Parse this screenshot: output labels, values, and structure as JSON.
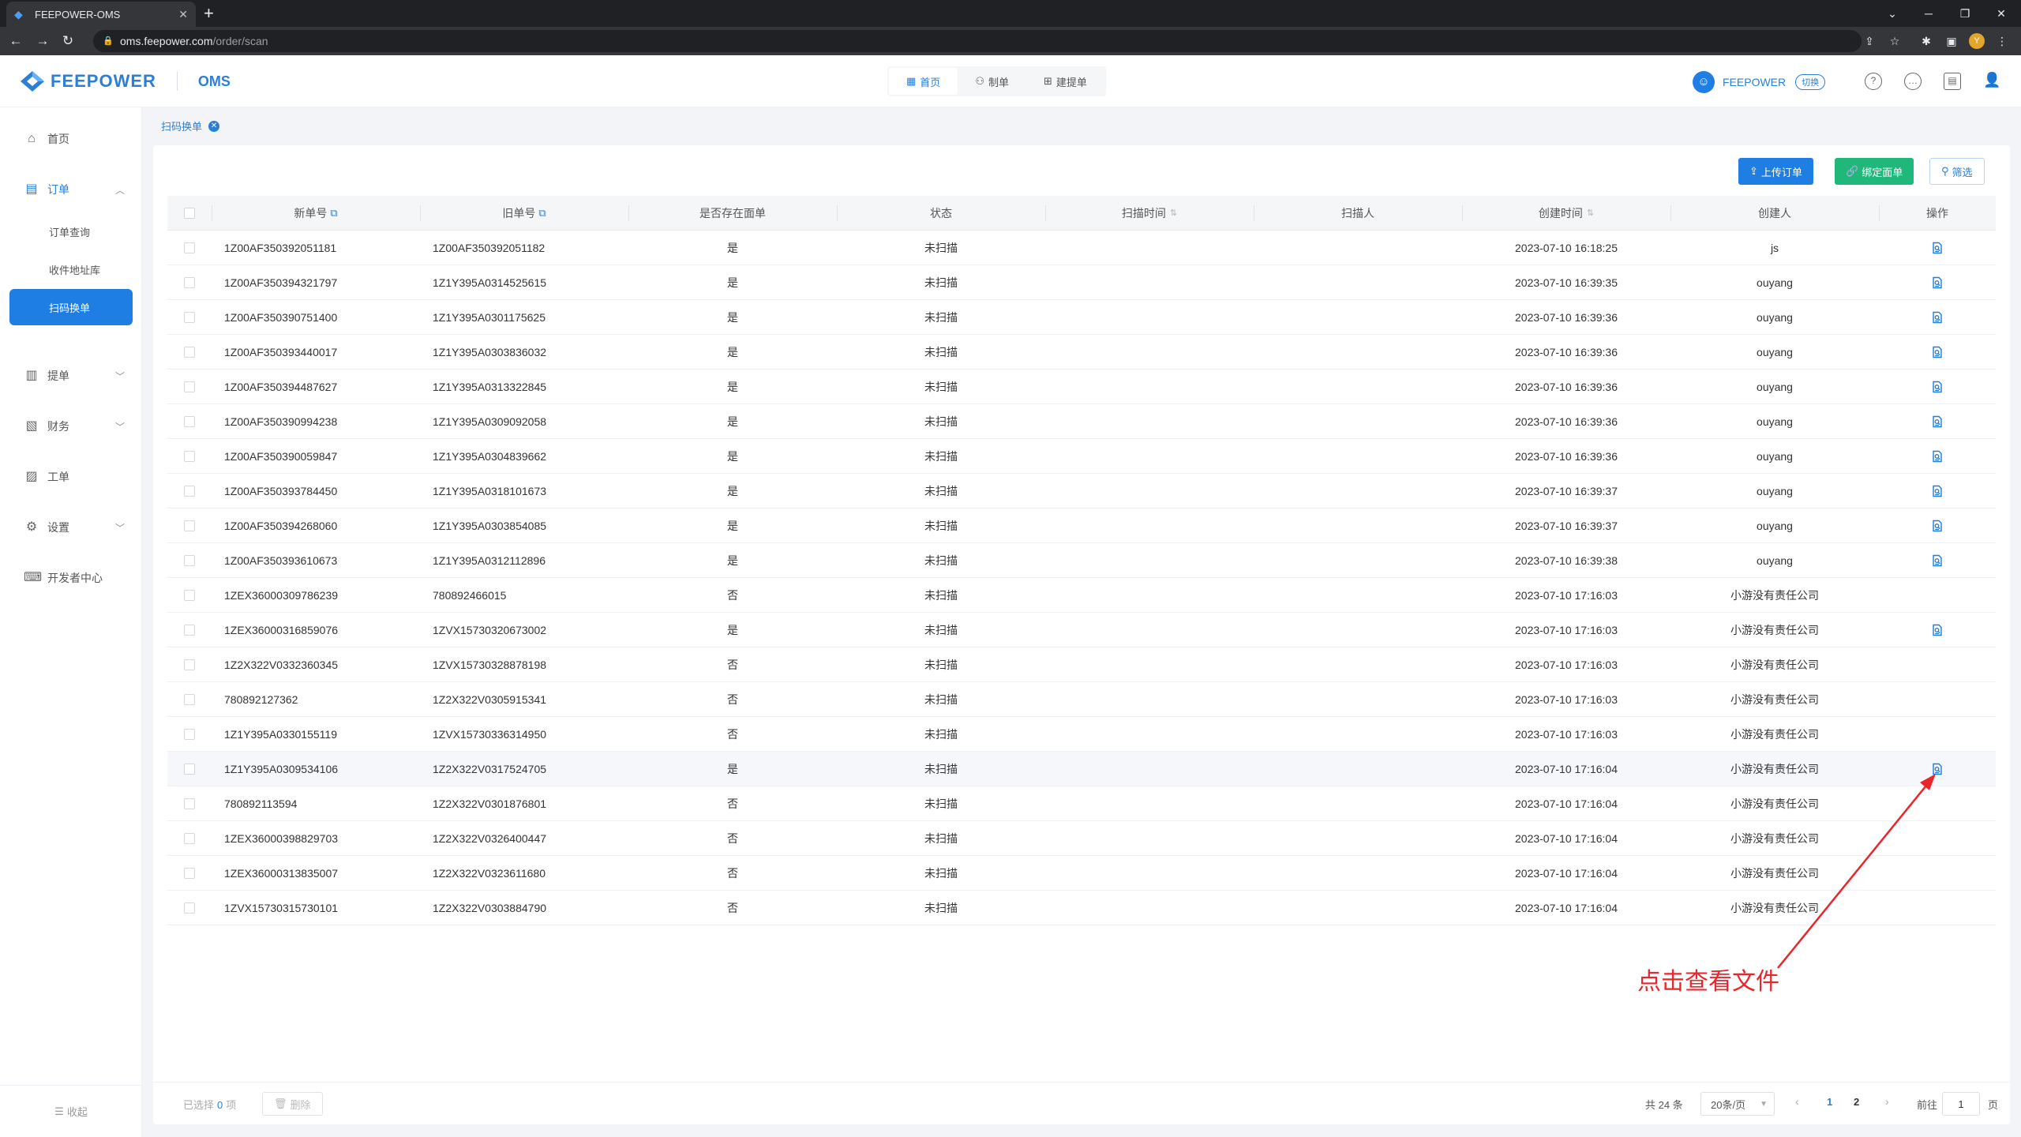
{
  "browser": {
    "tab_title": "FEEPOWER-OMS",
    "url_host": "oms.feepower.com",
    "url_path": "/order/scan",
    "profile_initial": "Y"
  },
  "header": {
    "logo_text": "FEEPOWER",
    "app_name": "OMS",
    "nav": [
      {
        "label": "首页",
        "icon": "grid-icon"
      },
      {
        "label": "制单",
        "icon": "user-form-icon"
      },
      {
        "label": "建提单",
        "icon": "doc-plus-icon"
      }
    ],
    "user_name": "FEEPOWER",
    "switch_label": "切换"
  },
  "sidebar": {
    "items": [
      {
        "label": "首页",
        "icon": "home-icon"
      },
      {
        "label": "订单",
        "icon": "order-icon"
      },
      {
        "label": "提单",
        "icon": "bill-icon"
      },
      {
        "label": "财务",
        "icon": "finance-icon"
      },
      {
        "label": "工单",
        "icon": "ticket-icon"
      },
      {
        "label": "设置",
        "icon": "settings-icon"
      },
      {
        "label": "开发者中心",
        "icon": "developer-icon"
      }
    ],
    "order_sub": [
      "订单查询",
      "收件地址库",
      "扫码换单"
    ],
    "collapse_label": "收起"
  },
  "breadcrumb": {
    "label": "扫码换单"
  },
  "toolbar": {
    "upload_label": "上传订单",
    "bind_label": "绑定面单",
    "filter_label": "筛选"
  },
  "table": {
    "headers": [
      "新单号",
      "旧单号",
      "是否存在面单",
      "状态",
      "扫描时间",
      "扫描人",
      "创建时间",
      "创建人",
      "操作"
    ],
    "rows": [
      {
        "new": "1Z00AF350392051181",
        "old": "1Z00AF350392051182",
        "exists": "是",
        "status": "未扫描",
        "scan_time": "",
        "scanner": "",
        "created": "2023-07-10 16:18:25",
        "creator": "js",
        "action": true
      },
      {
        "new": "1Z00AF350394321797",
        "old": "1Z1Y395A0314525615",
        "exists": "是",
        "status": "未扫描",
        "scan_time": "",
        "scanner": "",
        "created": "2023-07-10 16:39:35",
        "creator": "ouyang",
        "action": true
      },
      {
        "new": "1Z00AF350390751400",
        "old": "1Z1Y395A0301175625",
        "exists": "是",
        "status": "未扫描",
        "scan_time": "",
        "scanner": "",
        "created": "2023-07-10 16:39:36",
        "creator": "ouyang",
        "action": true
      },
      {
        "new": "1Z00AF350393440017",
        "old": "1Z1Y395A0303836032",
        "exists": "是",
        "status": "未扫描",
        "scan_time": "",
        "scanner": "",
        "created": "2023-07-10 16:39:36",
        "creator": "ouyang",
        "action": true
      },
      {
        "new": "1Z00AF350394487627",
        "old": "1Z1Y395A0313322845",
        "exists": "是",
        "status": "未扫描",
        "scan_time": "",
        "scanner": "",
        "created": "2023-07-10 16:39:36",
        "creator": "ouyang",
        "action": true
      },
      {
        "new": "1Z00AF350390994238",
        "old": "1Z1Y395A0309092058",
        "exists": "是",
        "status": "未扫描",
        "scan_time": "",
        "scanner": "",
        "created": "2023-07-10 16:39:36",
        "creator": "ouyang",
        "action": true
      },
      {
        "new": "1Z00AF350390059847",
        "old": "1Z1Y395A0304839662",
        "exists": "是",
        "status": "未扫描",
        "scan_time": "",
        "scanner": "",
        "created": "2023-07-10 16:39:36",
        "creator": "ouyang",
        "action": true
      },
      {
        "new": "1Z00AF350393784450",
        "old": "1Z1Y395A0318101673",
        "exists": "是",
        "status": "未扫描",
        "scan_time": "",
        "scanner": "",
        "created": "2023-07-10 16:39:37",
        "creator": "ouyang",
        "action": true
      },
      {
        "new": "1Z00AF350394268060",
        "old": "1Z1Y395A0303854085",
        "exists": "是",
        "status": "未扫描",
        "scan_time": "",
        "scanner": "",
        "created": "2023-07-10 16:39:37",
        "creator": "ouyang",
        "action": true
      },
      {
        "new": "1Z00AF350393610673",
        "old": "1Z1Y395A0312112896",
        "exists": "是",
        "status": "未扫描",
        "scan_time": "",
        "scanner": "",
        "created": "2023-07-10 16:39:38",
        "creator": "ouyang",
        "action": true
      },
      {
        "new": "1ZEX36000309786239",
        "old": "780892466015",
        "exists": "否",
        "status": "未扫描",
        "scan_time": "",
        "scanner": "",
        "created": "2023-07-10 17:16:03",
        "creator": "小游没有责任公司",
        "action": false
      },
      {
        "new": "1ZEX36000316859076",
        "old": "1ZVX15730320673002",
        "exists": "是",
        "status": "未扫描",
        "scan_time": "",
        "scanner": "",
        "created": "2023-07-10 17:16:03",
        "creator": "小游没有责任公司",
        "action": true
      },
      {
        "new": "1Z2X322V0332360345",
        "old": "1ZVX15730328878198",
        "exists": "否",
        "status": "未扫描",
        "scan_time": "",
        "scanner": "",
        "created": "2023-07-10 17:16:03",
        "creator": "小游没有责任公司",
        "action": false
      },
      {
        "new": "780892127362",
        "old": "1Z2X322V0305915341",
        "exists": "否",
        "status": "未扫描",
        "scan_time": "",
        "scanner": "",
        "created": "2023-07-10 17:16:03",
        "creator": "小游没有责任公司",
        "action": false
      },
      {
        "new": "1Z1Y395A0330155119",
        "old": "1ZVX15730336314950",
        "exists": "否",
        "status": "未扫描",
        "scan_time": "",
        "scanner": "",
        "created": "2023-07-10 17:16:03",
        "creator": "小游没有责任公司",
        "action": false
      },
      {
        "new": "1Z1Y395A0309534106",
        "old": "1Z2X322V0317524705",
        "exists": "是",
        "status": "未扫描",
        "scan_time": "",
        "scanner": "",
        "created": "2023-07-10 17:16:04",
        "creator": "小游没有责任公司",
        "action": true
      },
      {
        "new": "780892113594",
        "old": "1Z2X322V0301876801",
        "exists": "否",
        "status": "未扫描",
        "scan_time": "",
        "scanner": "",
        "created": "2023-07-10 17:16:04",
        "creator": "小游没有责任公司",
        "action": false
      },
      {
        "new": "1ZEX36000398829703",
        "old": "1Z2X322V0326400447",
        "exists": "否",
        "status": "未扫描",
        "scan_time": "",
        "scanner": "",
        "created": "2023-07-10 17:16:04",
        "creator": "小游没有责任公司",
        "action": false
      },
      {
        "new": "1ZEX36000313835007",
        "old": "1Z2X322V0323611680",
        "exists": "否",
        "status": "未扫描",
        "scan_time": "",
        "scanner": "",
        "created": "2023-07-10 17:16:04",
        "creator": "小游没有责任公司",
        "action": false
      },
      {
        "new": "1ZVX15730315730101",
        "old": "1Z2X322V0303884790",
        "exists": "否",
        "status": "未扫描",
        "scan_time": "",
        "scanner": "",
        "created": "2023-07-10 17:16:04",
        "creator": "小游没有责任公司",
        "action": false
      }
    ]
  },
  "footer": {
    "selected_prefix": "已选择",
    "selected_count": "0",
    "selected_suffix": "项",
    "delete_label": "删除",
    "total": "共 24 条",
    "page_size": "20条/页",
    "pages": [
      "1",
      "2"
    ],
    "current_page": "1",
    "goto_label": "前往",
    "goto_value": "1",
    "goto_unit": "页"
  },
  "annotation": {
    "text": "点击查看文件",
    "color": "#e8262b"
  },
  "colors": {
    "primary": "#1e7ee3",
    "success": "#1fb87a",
    "link": "#2b7fd4"
  }
}
